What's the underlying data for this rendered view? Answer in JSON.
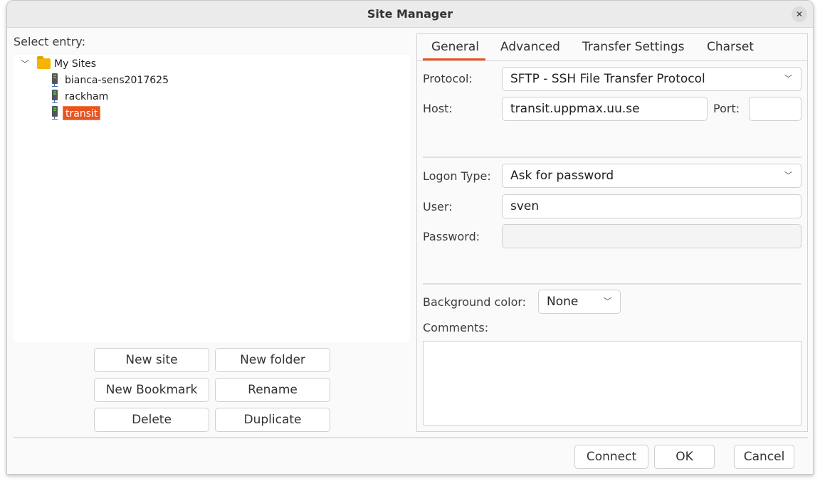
{
  "window": {
    "title": "Site Manager",
    "close_icon": "close-icon"
  },
  "left": {
    "select_entry_label": "Select entry:",
    "tree": {
      "root": "My Sites",
      "items": [
        {
          "label": "bianca-sens2017625"
        },
        {
          "label": "rackham"
        },
        {
          "label": "transit",
          "selected": true
        }
      ]
    },
    "buttons": {
      "new_site": "New site",
      "new_folder": "New folder",
      "new_bookmark": "New Bookmark",
      "rename": "Rename",
      "delete": "Delete",
      "duplicate": "Duplicate"
    }
  },
  "tabs": [
    {
      "label": "General",
      "active": true
    },
    {
      "label": "Advanced"
    },
    {
      "label": "Transfer Settings"
    },
    {
      "label": "Charset"
    }
  ],
  "general": {
    "protocol_label": "Protocol:",
    "protocol_value": "SFTP - SSH File Transfer Protocol",
    "host_label": "Host:",
    "host_value": "transit.uppmax.uu.se",
    "port_label": "Port:",
    "port_value": "",
    "logon_type_label": "Logon Type:",
    "logon_type_value": "Ask for password",
    "user_label": "User:",
    "user_value": "sven",
    "password_label": "Password:",
    "password_value": "",
    "bg_color_label": "Background color:",
    "bg_color_value": "None",
    "comments_label": "Comments:",
    "comments_value": ""
  },
  "footer": {
    "connect": "Connect",
    "ok": "OK",
    "cancel": "Cancel"
  },
  "colors": {
    "accent": "#e95420",
    "selection": "#e95420",
    "folder": "#f5b400"
  }
}
